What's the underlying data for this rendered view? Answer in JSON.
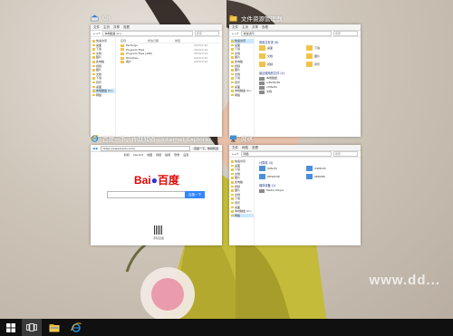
{
  "desktop": {
    "watermark": "www.dd..."
  },
  "windows": [
    {
      "id": "c-drive",
      "title": "C:\\",
      "icon": "drive-icon",
      "address": "本地磁盘 (C:)",
      "nav": [
        "快速访问",
        "桌面",
        "下载",
        "文档",
        "图片",
        "此电脑",
        "视频",
        "图片",
        "文档",
        "下载",
        "音乐",
        "桌面",
        "本地磁盘 (C:)",
        "网络"
      ],
      "header": [
        "名称",
        "修改日期",
        "类型"
      ],
      "files": [
        {
          "name": "PerfLogs",
          "date": "2015/7/10"
        },
        {
          "name": "Program Files",
          "date": "2015/7/10"
        },
        {
          "name": "Program Files (x86)",
          "date": "2015/7/10"
        },
        {
          "name": "Windows",
          "date": "2015/7/10"
        },
        {
          "name": "用户",
          "date": "2015/7/10"
        }
      ]
    },
    {
      "id": "file-explorer",
      "title": "文件资源管理器",
      "icon": "folder-icon",
      "address": "快速访问",
      "nav": [
        "快速访问",
        "桌面",
        "下载",
        "文档",
        "图片",
        "此电脑",
        "视频",
        "图片",
        "文档",
        "下载",
        "音乐",
        "桌面",
        "本地磁盘 (C:)",
        "网络"
      ],
      "section_folders": "常用文件夹 (6)",
      "folders": [
        "桌面",
        "下载",
        "文档",
        "图片",
        "视频",
        "音乐"
      ],
      "section_recent": "最近使用的文件 (4)",
      "recent": [
        "本地磁盘",
        "sdfsdfsdfs",
        "cfdfsdfs",
        "文档"
      ]
    },
    {
      "id": "internet-explorer",
      "title": "百度一下，你就知道 - Internet Explorer",
      "icon": "ie-icon",
      "url": "https://www.baidu.com/",
      "tab": "百度一下，你就知道",
      "nav_links": [
        "新闻",
        "hao123",
        "地图",
        "视频",
        "贴吧",
        "登录",
        "设置"
      ],
      "logo_left": "Bai",
      "logo_right": "百度",
      "search_button": "百度一下",
      "qr_caption": "手机百度"
    },
    {
      "id": "network",
      "title": "网络",
      "icon": "network-icon",
      "address": "网络",
      "nav": [
        "快速访问",
        "桌面",
        "下载",
        "文档",
        "图片",
        "此电脑",
        "视频",
        "图片",
        "文档",
        "下载",
        "音乐",
        "桌面",
        "本地磁盘 (C:)",
        "网络"
      ],
      "section_computers": "计算机 (4)",
      "computers": [
        "WIN-PC",
        "USER-PC",
        "DESKTOP",
        "SERVER"
      ],
      "section_media": "媒体设备 (1)",
      "media": [
        "Media Player"
      ]
    }
  ],
  "taskbar": {
    "items": [
      "start",
      "task-view",
      "file-explorer",
      "internet-explorer"
    ],
    "accent": "#101010"
  }
}
